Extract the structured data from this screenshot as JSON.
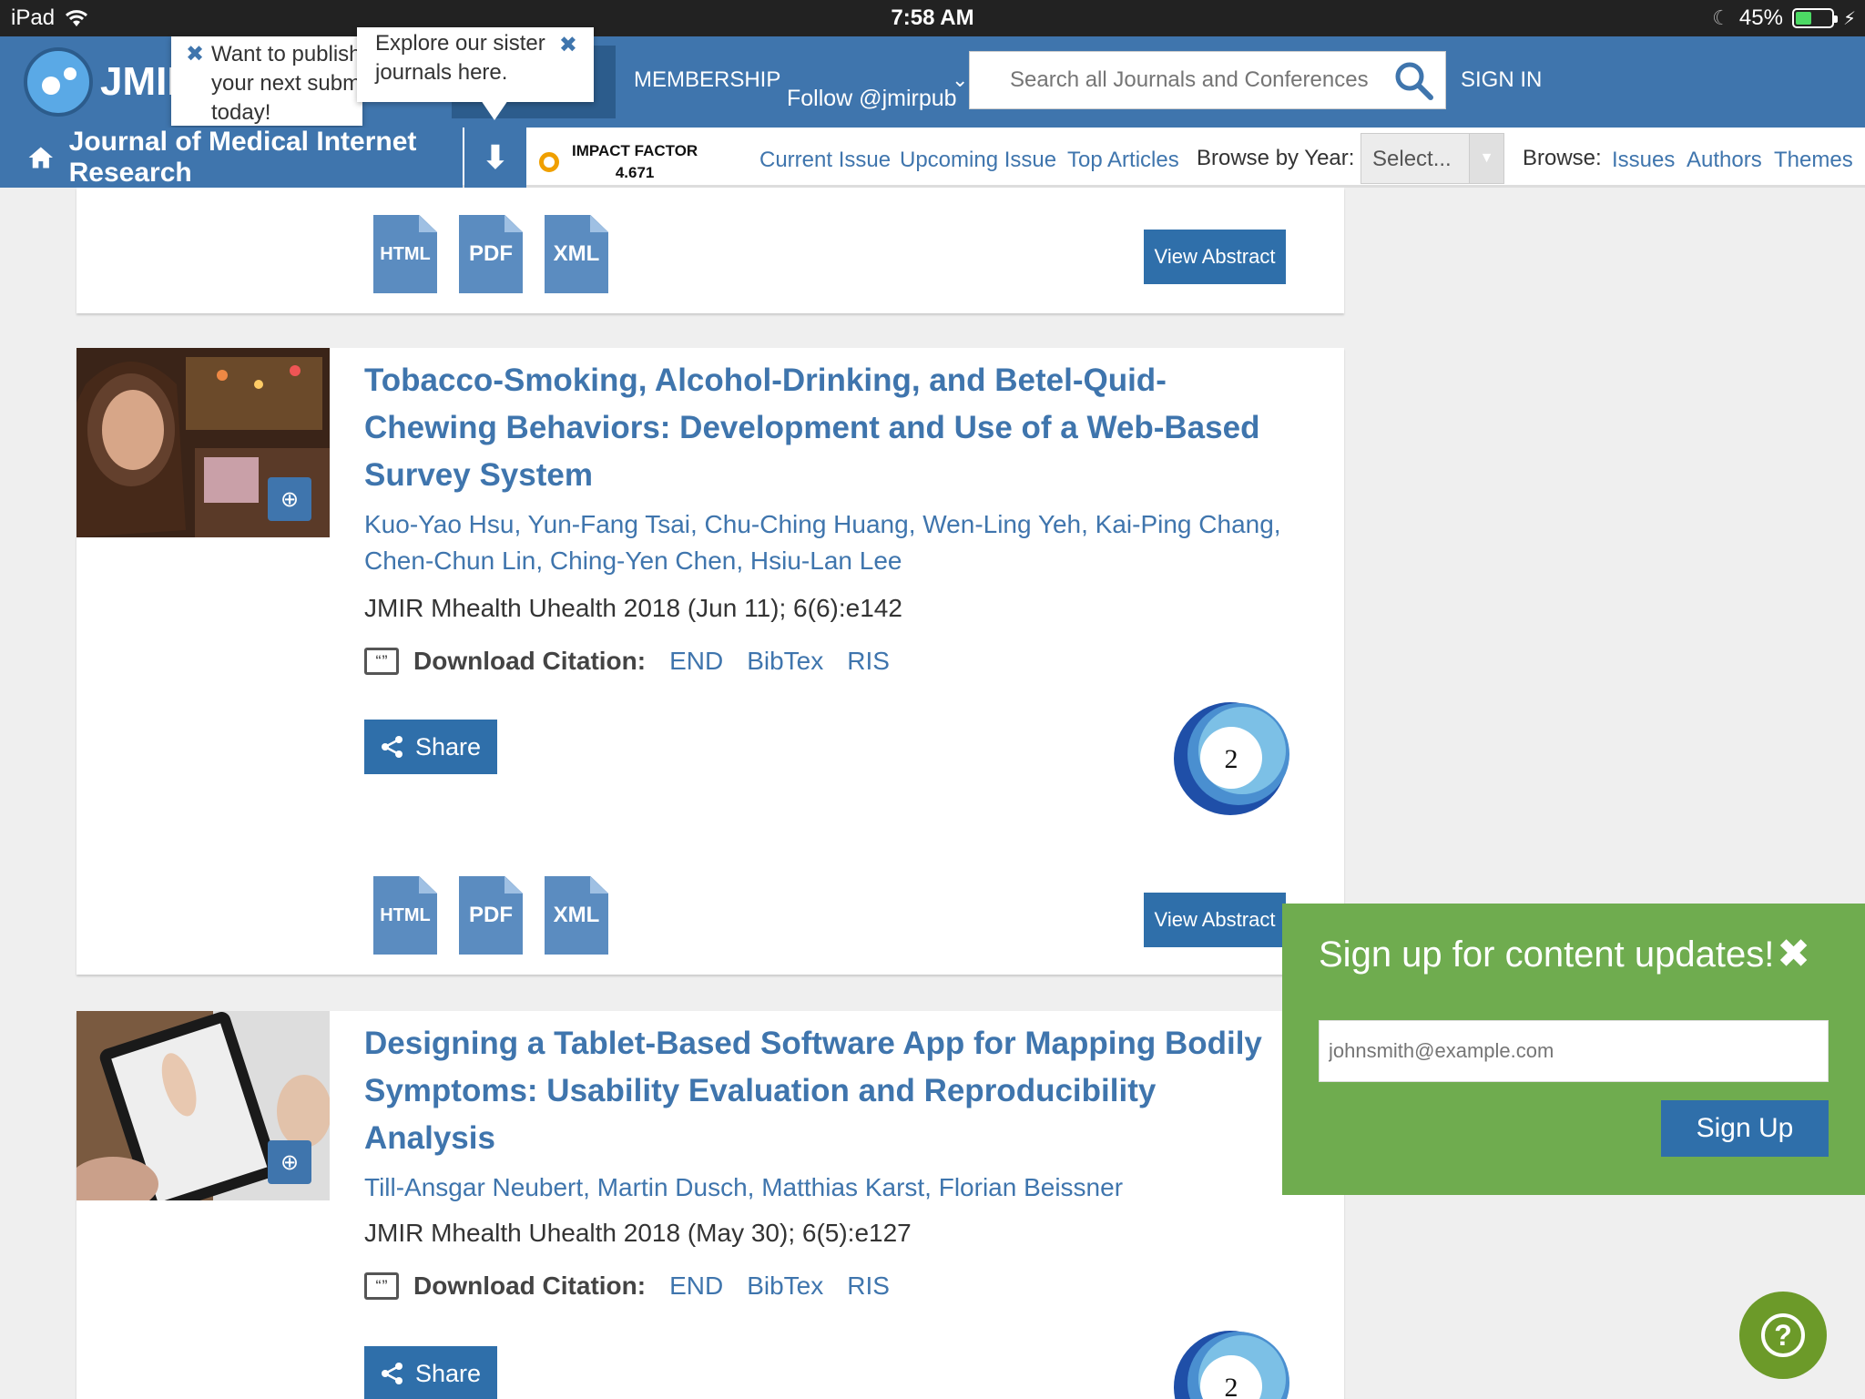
{
  "status_bar": {
    "device": "iPad",
    "time": "7:58 AM",
    "battery": "45%",
    "battery_level": 0.45
  },
  "header": {
    "logo_text": "JMIR",
    "tooltip_publish": [
      "Want to publish",
      "your next subm",
      "today!"
    ],
    "tooltip_sister": [
      "Explore our sister",
      "journals here."
    ],
    "membership": "MEMBERSHIP",
    "follow": "Follow @jmirpub",
    "search_placeholder": "Search all Journals and Conferences",
    "sign_in": "SIGN IN"
  },
  "nav": {
    "journal": "Journal of Medical Internet Research",
    "impact_label": "IMPACT FACTOR",
    "impact_value": "4.671",
    "current_issue": "Current Issue",
    "upcoming_issue": "Upcoming Issue",
    "top_articles": "Top Articles",
    "browse_year_label": "Browse by Year:",
    "select_value": "Select...",
    "browse_label": "Browse:",
    "issues": "Issues",
    "authors": "Authors",
    "themes": "Themes"
  },
  "common": {
    "html": "HTML",
    "pdf": "PDF",
    "xml": "XML",
    "view_abstract": "View Abstract",
    "download_citation": "Download Citation:",
    "end": "END",
    "bibtex": "BibTex",
    "ris": "RIS",
    "share": "Share"
  },
  "articles": [
    {
      "title_lines": [
        "Tobacco-Smoking, Alcohol-Drinking, and Betel-Quid-",
        "Chewing Behaviors: Development and Use of a Web-Based",
        "Survey System"
      ],
      "authors_lines": [
        "Kuo-Yao Hsu, Yun-Fang Tsai, Chu-Ching Huang, Wen-Ling Yeh, Kai-Ping Chang,",
        "Chen-Chun Lin, Ching-Yen Chen, Hsiu-Lan Lee"
      ],
      "citation": "JMIR Mhealth Uhealth 2018 (Jun 11); 6(6):e142",
      "altmetric": "2"
    },
    {
      "title_lines": [
        "Designing a Tablet-Based Software App for Mapping Bodily",
        "Symptoms: Usability Evaluation and Reproducibility",
        "Analysis"
      ],
      "authors_lines": [
        "Till-Ansgar Neubert, Martin Dusch, Matthias Karst, Florian Beissner"
      ],
      "citation": "JMIR Mhealth Uhealth 2018 (May 30); 6(5):e127",
      "altmetric": "2"
    }
  ],
  "signup": {
    "heading": "Sign up for content updates!",
    "email_placeholder": "johnsmith@example.com",
    "button": "Sign Up"
  },
  "help_icon": "?",
  "colors": {
    "brand_blue": "#3f75ad",
    "button_blue": "#2f6faa",
    "signup_green": "#6fac4f",
    "help_green": "#6c9a29"
  }
}
